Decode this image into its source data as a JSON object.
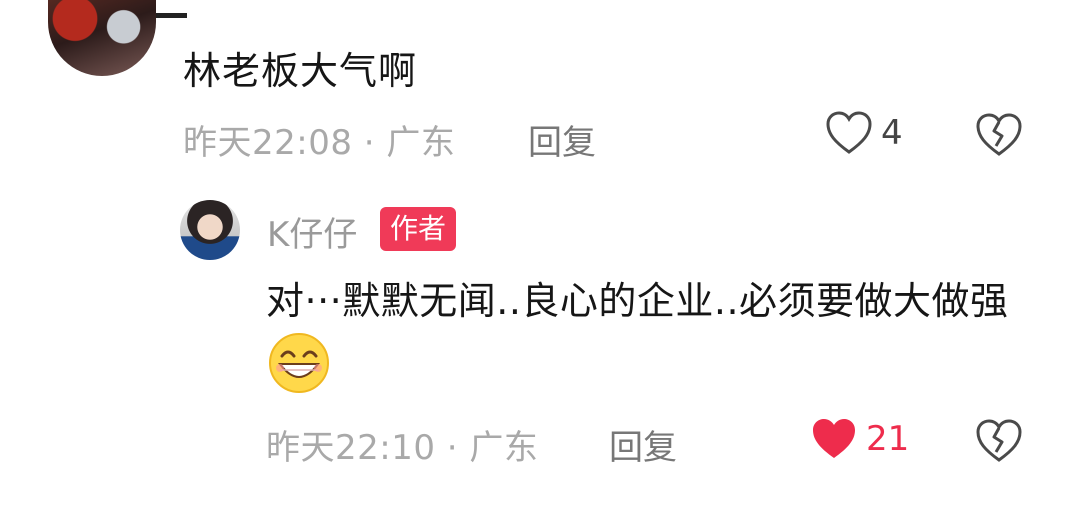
{
  "comment1": {
    "text": "林老板大气啊",
    "meta": "昨天22:08 · 广东",
    "reply_label": "回复",
    "likes": "4",
    "liked": false
  },
  "comment2": {
    "author": "K仔仔",
    "badge": "作者",
    "text": "对···默默无闻..良心的企业..必须要做大做强",
    "emoji": "grinning-face-emoji",
    "meta": "昨天22:10 · 广东",
    "reply_label": "回复",
    "likes": "21",
    "liked": true
  },
  "colors": {
    "accent_red": "#ee2c4c",
    "badge_red": "#f03a58",
    "meta_gray": "#a9a9a9"
  }
}
